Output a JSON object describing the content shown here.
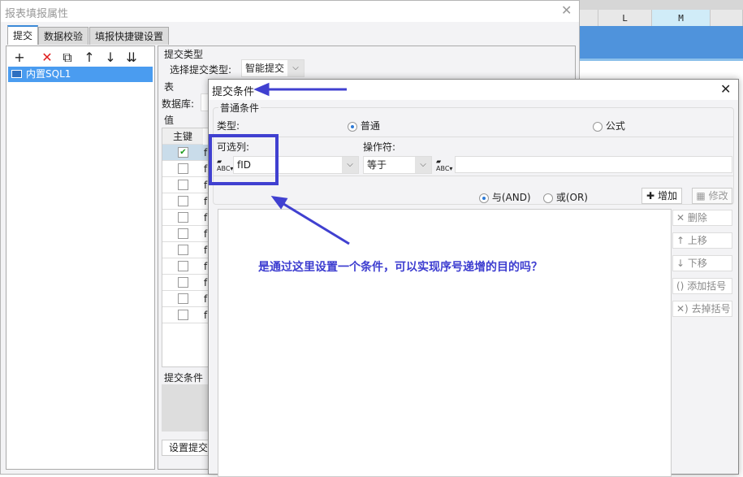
{
  "spreadsheet": {
    "columns": [
      "L",
      "M"
    ]
  },
  "main_dialog": {
    "title": "报表填报属性",
    "tabs": [
      "提交",
      "数据校验",
      "填报快捷键设置"
    ],
    "toolbar": {
      "add": "+",
      "delete": "✕",
      "copy": "⧉",
      "up": "↑",
      "down": "↓",
      "merge": "⇊"
    },
    "tree_items": [
      "内置SQL1"
    ],
    "submit_type_section": "提交类型",
    "submit_type_label": "选择提交类型:",
    "submit_type_value": "智能提交",
    "table_section": "表",
    "database_label": "数据库:",
    "value_section": "值",
    "key_header": "主键",
    "rows": [
      {
        "checked": true,
        "field": "f"
      },
      {
        "checked": false,
        "field": "f"
      },
      {
        "checked": false,
        "field": "f"
      },
      {
        "checked": false,
        "field": "f"
      },
      {
        "checked": false,
        "field": "f"
      },
      {
        "checked": false,
        "field": "f"
      },
      {
        "checked": false,
        "field": "f"
      },
      {
        "checked": false,
        "field": "f"
      },
      {
        "checked": false,
        "field": "f"
      },
      {
        "checked": false,
        "field": "f"
      },
      {
        "checked": false,
        "field": "f"
      }
    ],
    "submit_condition_section": "提交条件",
    "set_condition_button": "设置提交"
  },
  "condition_dialog": {
    "title": "提交条件",
    "group_title": "普通条件",
    "type_label": "类型:",
    "type_options": [
      {
        "label": "普通",
        "selected": true
      },
      {
        "label": "公式",
        "selected": false
      }
    ],
    "column_label": "可选列:",
    "column_value": "fID",
    "operator_label": "操作符:",
    "operator_value": "等于",
    "value_input": "",
    "logic_options": [
      {
        "label": "与(AND)",
        "selected": true
      },
      {
        "label": "或(OR)",
        "selected": false
      }
    ],
    "add_button": "增加",
    "modify_button": "修改",
    "side_buttons": [
      {
        "icon": "✕",
        "label": "删除"
      },
      {
        "icon": "↑",
        "label": "上移"
      },
      {
        "icon": "↓",
        "label": "下移"
      },
      {
        "icon": "()",
        "label": "添加括号"
      },
      {
        "icon": "✕)",
        "label": "去掉括号"
      }
    ]
  },
  "annotation": {
    "text": "是通过这里设置一个条件，可以实现序号递增的目的吗？",
    "color": "#3d3dd0"
  }
}
